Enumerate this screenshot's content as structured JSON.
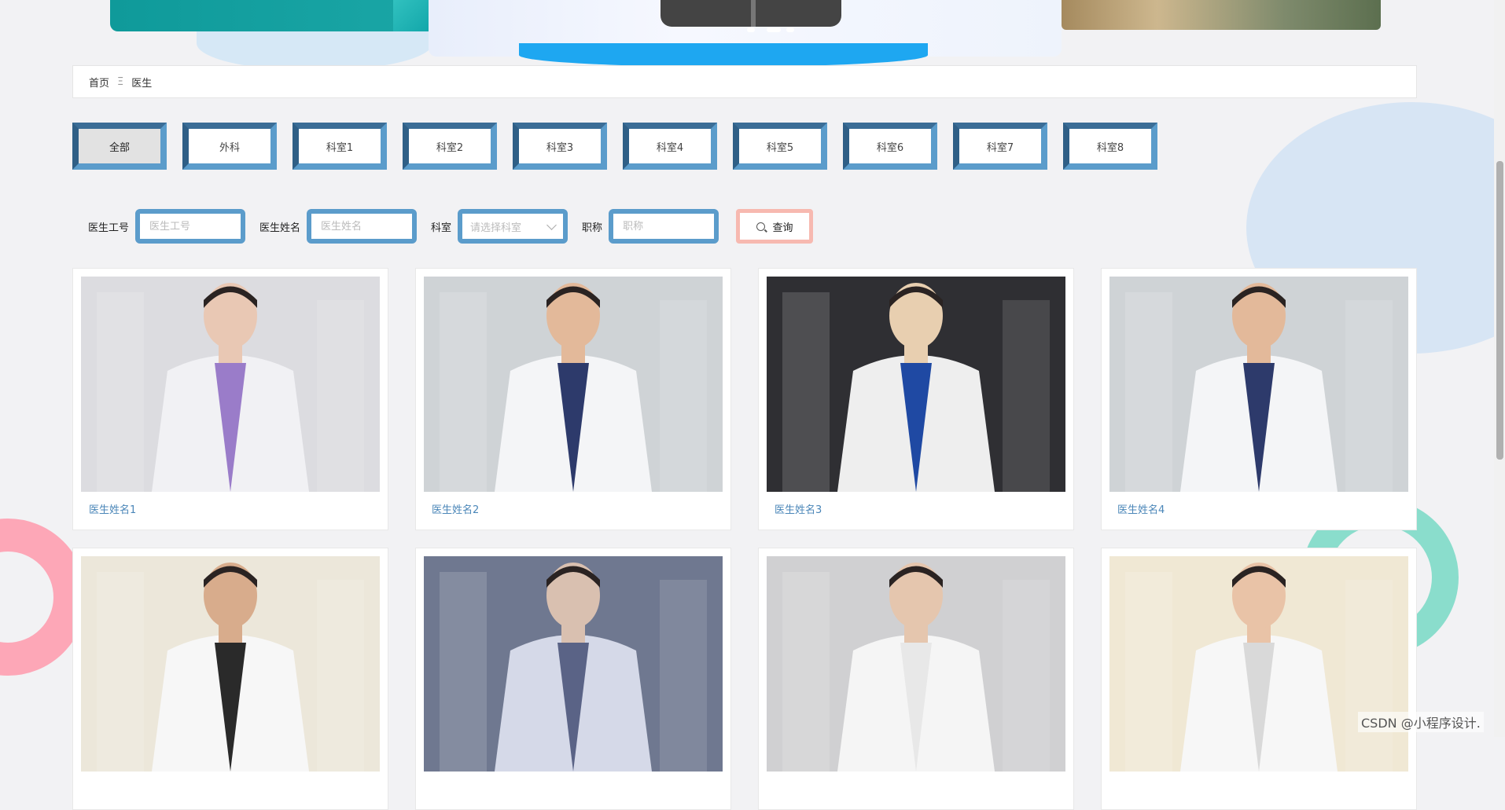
{
  "breadcrumb": {
    "home": "首页",
    "separator": "Ξ",
    "current": "医生"
  },
  "categories": [
    "全部",
    "外科",
    "科室1",
    "科室2",
    "科室3",
    "科室4",
    "科室5",
    "科室6",
    "科室7",
    "科室8"
  ],
  "active_category": "全部",
  "search": {
    "worker_id_label": "医生工号",
    "worker_id_placeholder": "医生工号",
    "name_label": "医生姓名",
    "name_placeholder": "医生姓名",
    "dept_label": "科室",
    "dept_placeholder": "请选择科室",
    "title_label": "职称",
    "title_placeholder": "职称",
    "query_label": "查询"
  },
  "doctors": [
    {
      "name": "医生姓名1",
      "bg": "#dcdce0",
      "coat": "#f1f1f4",
      "inner": "#9a7cc9",
      "skin": "#e9c8b4"
    },
    {
      "name": "医生姓名2",
      "bg": "#cfd3d6",
      "coat": "#f4f5f7",
      "inner": "#2d3a6b",
      "skin": "#e3b99a"
    },
    {
      "name": "医生姓名3",
      "bg": "#2f2f33",
      "coat": "#eeeeee",
      "inner": "#1f49a3",
      "skin": "#e8cfb0"
    },
    {
      "name": "医生姓名4",
      "bg": "#cfd3d6",
      "coat": "#f4f5f7",
      "inner": "#2d3a6b",
      "skin": "#e3b99a"
    },
    {
      "name": "",
      "bg": "#ece7da",
      "coat": "#f7f7f7",
      "inner": "#2a2a2a",
      "skin": "#d8ac8c"
    },
    {
      "name": "",
      "bg": "#6f7890",
      "coat": "#d5d9e8",
      "inner": "#5a6386",
      "skin": "#d9c0b0"
    },
    {
      "name": "",
      "bg": "#d0d0d2",
      "coat": "#f5f5f5",
      "inner": "#e8e8e8",
      "skin": "#e5c6ae"
    },
    {
      "name": "",
      "bg": "#f0e8d4",
      "coat": "#f7f7f7",
      "inner": "#d9d9d9",
      "skin": "#e9c3a7"
    }
  ],
  "watermark": "CSDN @小程序设计.",
  "icons": {
    "search": "search-icon",
    "dropdown": "chevron-down-icon"
  }
}
